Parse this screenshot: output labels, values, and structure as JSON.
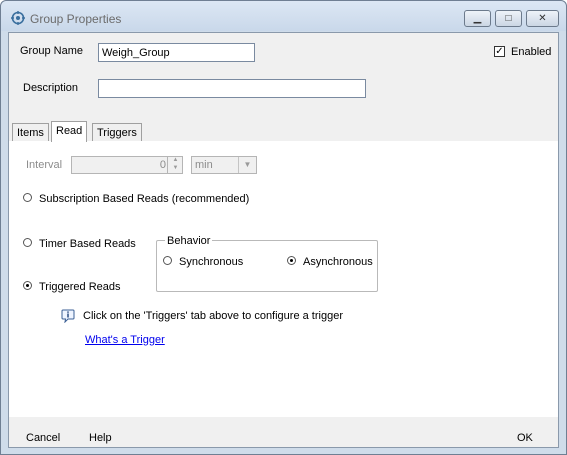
{
  "window": {
    "title": "Group Properties",
    "minimize_glyph": "▁",
    "maximize_glyph": "□",
    "close_glyph": "✕"
  },
  "form": {
    "group_name_label": "Group Name",
    "group_name_value": "Weigh_Group",
    "enabled_label": "Enabled",
    "enabled_checked": true,
    "description_label": "Description",
    "description_value": ""
  },
  "tabs": [
    {
      "label": "Items",
      "active": false
    },
    {
      "label": "Read",
      "active": true
    },
    {
      "label": "Triggers",
      "active": false
    }
  ],
  "read": {
    "interval_label": "Interval",
    "interval_value": "0",
    "interval_unit": "min",
    "subscription_label": "Subscription Based Reads  (recommended)",
    "timer_label": "Timer Based Reads",
    "triggered_label": "Triggered Reads",
    "selected_mode": "triggered",
    "behavior": {
      "title": "Behavior",
      "synchronous_label": "Synchronous",
      "asynchronous_label": "Asynchronous",
      "selected": "asynchronous"
    },
    "info_text": "Click on the 'Triggers' tab above to configure a trigger",
    "link_text": "What's a Trigger"
  },
  "buttons": {
    "cancel": "Cancel",
    "help": "Help",
    "ok": "OK"
  },
  "colors": {
    "titlebar": "#c9d8ea",
    "panel": "#ffffff",
    "link": "#0000ee"
  }
}
